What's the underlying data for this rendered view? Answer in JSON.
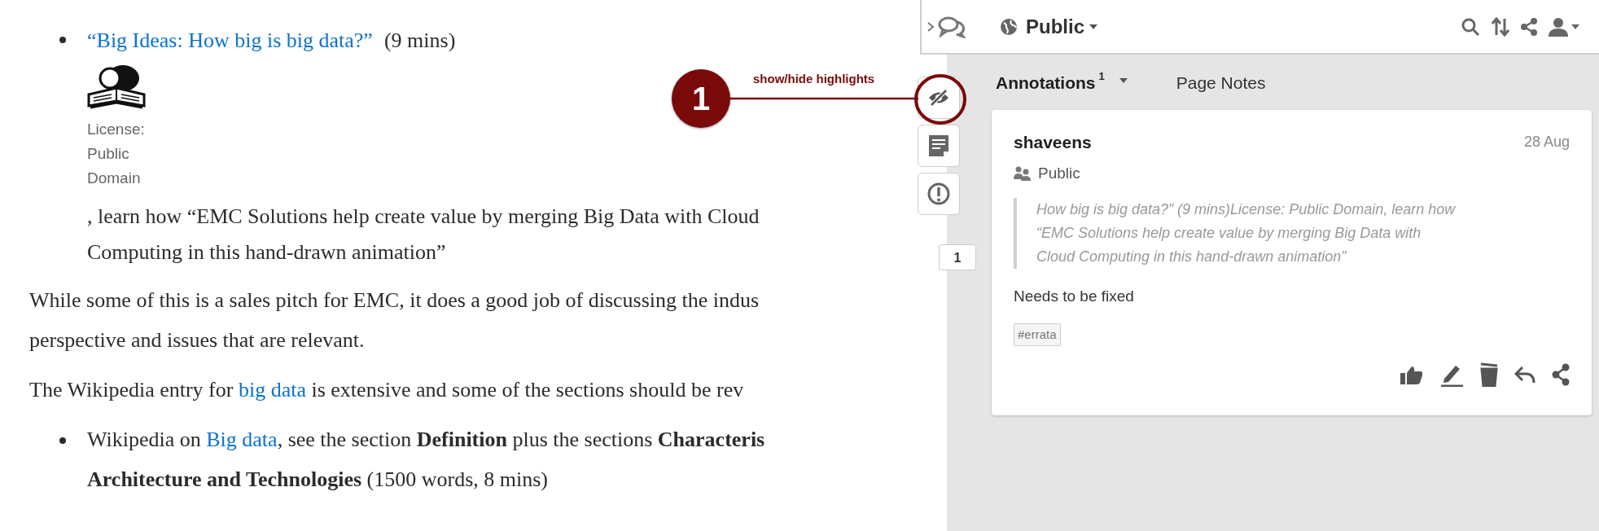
{
  "article": {
    "video_item": {
      "link": "“Big Ideas: How big is big data?”",
      "duration": "(9 mins)",
      "license": "License: Public Domain",
      "caption_lines": [
        ", learn how “EMC Solutions help create value by merging Big Data with Cloud",
        "Computing in this hand-drawn animation”"
      ]
    },
    "paragraphs": [
      {
        "kind": "paragraph",
        "lines": [
          [
            {
              "kind": "text",
              "text": "While some of this is a sales pitch for EMC, it does a good job of discussing the indus"
            }
          ],
          [
            {
              "kind": "text",
              "text": "perspective and issues that are relevant."
            }
          ]
        ]
      },
      {
        "kind": "paragraph",
        "lines": [
          [
            {
              "kind": "text",
              "text": "The Wikipedia entry for "
            },
            {
              "kind": "link",
              "text": "big data"
            },
            {
              "kind": "text",
              "text": " is extensive and some of the sections should be rev"
            }
          ]
        ]
      },
      {
        "kind": "bullet",
        "lines": [
          [
            {
              "kind": "text",
              "text": "Wikipedia on "
            },
            {
              "kind": "link",
              "text": "Big data"
            },
            {
              "kind": "text",
              "text": ", see the section **Definition** plus the sections **Characteris**"
            }
          ],
          [
            {
              "kind": "text",
              "text": "**Architecture and Technologies** (1500 words, 8 mins)"
            }
          ]
        ]
      }
    ]
  },
  "sidebar": {
    "toolbar": {
      "scope": "Public"
    },
    "tabs": [
      {
        "label": "Annotations",
        "count": "1",
        "selected": true
      },
      {
        "label": "Page Notes",
        "selected": false
      }
    ],
    "annotation": {
      "user": "shaveens",
      "date": "28 Aug",
      "visibility": "Public",
      "quote": "How big is big data?”  (9 mins)License: Public Domain, learn how “EMC Solutions help create value by merging Big Data with Cloud Computing in this hand-drawn animation”",
      "text": "Needs to be fixed",
      "tags": [
        "#errata"
      ]
    },
    "highlight_count": "1"
  },
  "callout": {
    "number": "1",
    "label": "show/hide highlights"
  }
}
